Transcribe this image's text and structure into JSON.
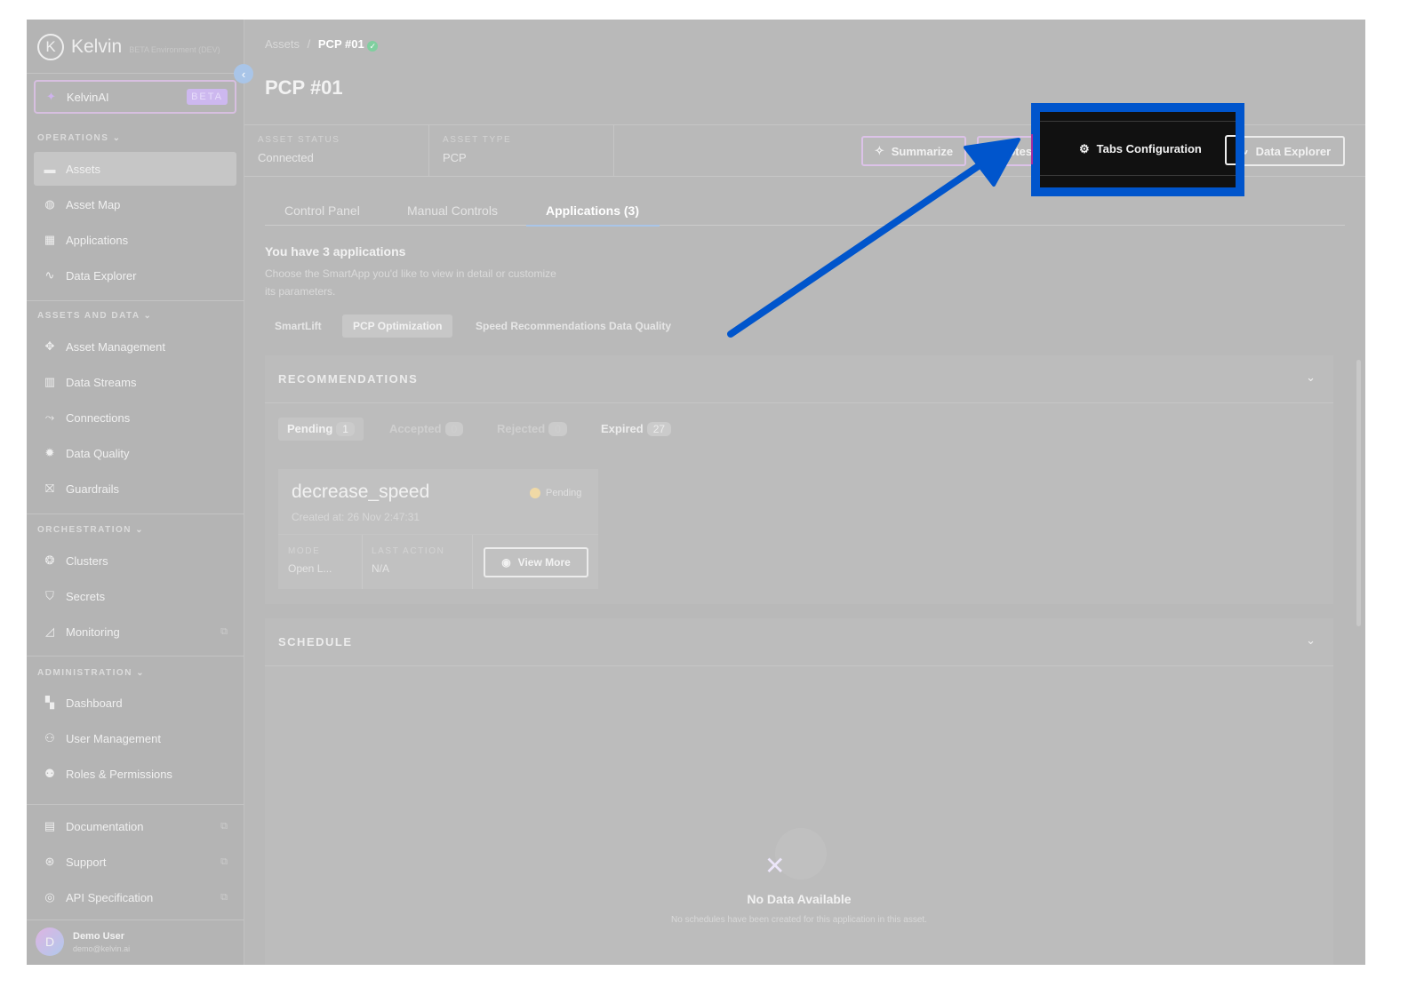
{
  "brand": {
    "name": "Kelvin",
    "logo_letter": "K",
    "environment": "BETA Environment (DEV)"
  },
  "kelvin_ai": {
    "label": "KelvinAI",
    "badge": "BETA"
  },
  "sidebar": {
    "sections": [
      {
        "title": "OPERATIONS",
        "items": [
          {
            "label": "Assets",
            "icon": "assets-icon",
            "glyph": "▬",
            "active": true
          },
          {
            "label": "Asset Map",
            "icon": "globe-icon",
            "glyph": "◍"
          },
          {
            "label": "Applications",
            "icon": "apps-grid-icon",
            "glyph": "▦"
          },
          {
            "label": "Data Explorer",
            "icon": "pulse-icon",
            "glyph": "∿"
          }
        ]
      },
      {
        "title": "ASSETS AND DATA",
        "items": [
          {
            "label": "Asset Management",
            "icon": "asset-management-icon",
            "glyph": "✥"
          },
          {
            "label": "Data Streams",
            "icon": "bar-chart-icon",
            "glyph": "▥"
          },
          {
            "label": "Connections",
            "icon": "connections-icon",
            "glyph": "⤳"
          },
          {
            "label": "Data Quality",
            "icon": "gear-check-icon",
            "glyph": "✹"
          },
          {
            "label": "Guardrails",
            "icon": "barrier-icon",
            "glyph": "⛝"
          }
        ]
      },
      {
        "title": "ORCHESTRATION",
        "items": [
          {
            "label": "Clusters",
            "icon": "clusters-icon",
            "glyph": "❂"
          },
          {
            "label": "Secrets",
            "icon": "shield-icon",
            "glyph": "⛉"
          },
          {
            "label": "Monitoring",
            "icon": "monitoring-icon",
            "glyph": "◿",
            "external": true
          }
        ]
      },
      {
        "title": "ADMINISTRATION",
        "items": [
          {
            "label": "Dashboard",
            "icon": "dashboard-icon",
            "glyph": "▚"
          },
          {
            "label": "User Management",
            "icon": "users-icon",
            "glyph": "⚇"
          },
          {
            "label": "Roles & Permissions",
            "icon": "user-gear-icon",
            "glyph": "⚉"
          }
        ]
      },
      {
        "title": "",
        "items": [
          {
            "label": "Documentation",
            "icon": "document-icon",
            "glyph": "▤",
            "external": true
          },
          {
            "label": "Support",
            "icon": "lifebuoy-icon",
            "glyph": "⊛",
            "external": true
          },
          {
            "label": "API Specification",
            "icon": "api-globe-icon",
            "glyph": "◎",
            "external": true
          }
        ]
      }
    ]
  },
  "user": {
    "initial": "D",
    "name": "Demo User",
    "email": "demo@kelvin.ai"
  },
  "breadcrumb": {
    "parent": "Assets",
    "separator": "/",
    "current": "PCP #01"
  },
  "page_title": "PCP #01",
  "info": {
    "status_label": "ASSET STATUS",
    "status_value": "Connected",
    "type_label": "ASSET TYPE",
    "type_value": "PCP"
  },
  "actions": {
    "summarize": "Summarize",
    "notes": "Notes",
    "tabs_configuration": "Tabs Configuration",
    "data_explorer": "Data Explorer"
  },
  "tabs": [
    {
      "label": "Control Panel"
    },
    {
      "label": "Manual Controls"
    },
    {
      "label": "Applications (3)",
      "active": true
    }
  ],
  "applications": {
    "heading": "You have 3 applications",
    "description_line1": "Choose the SmartApp you'd like to view in detail or customize",
    "description_line2": "its parameters.",
    "apps": [
      {
        "label": "SmartLift"
      },
      {
        "label": "PCP Optimization",
        "active": true
      },
      {
        "label": "Speed Recommendations Data Quality"
      }
    ]
  },
  "recommendations": {
    "title": "RECOMMENDATIONS",
    "filters": [
      {
        "label": "Pending",
        "count": "1",
        "active": true
      },
      {
        "label": "Accepted",
        "count": "0"
      },
      {
        "label": "Rejected",
        "count": "0"
      },
      {
        "label": "Expired",
        "count": "27"
      }
    ],
    "card": {
      "name": "decrease_speed",
      "status": "Pending",
      "created": "Created at: 26 Nov 2:47:31",
      "mode_label": "MODE",
      "mode_value": "Open L...",
      "last_action_label": "LAST ACTION",
      "last_action_value": "N/A",
      "view_more": "View More"
    }
  },
  "schedule": {
    "title": "SCHEDULE",
    "empty_title": "No Data Available",
    "empty_text": "No schedules have been created for this application in this asset."
  },
  "colors": {
    "annotation_blue": "#0055cc",
    "highlight_bg": "#111111",
    "status_ok": "#7fcf9f",
    "pending": "#f0d9a6",
    "ai_purple": "#cdb8ef"
  }
}
